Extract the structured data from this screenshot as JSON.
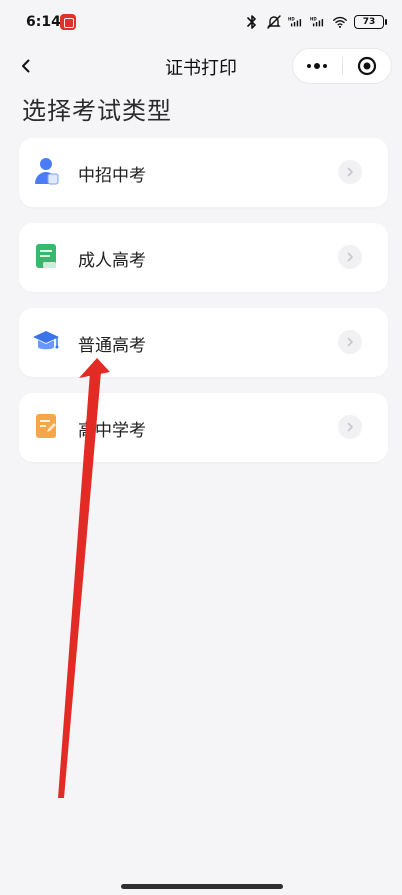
{
  "status_bar": {
    "time": "6:14",
    "battery": "73",
    "icons": [
      "bluetooth-icon",
      "mute-bell-icon",
      "hd-signal-icon",
      "hd-signal-icon",
      "wifi-icon",
      "battery-icon"
    ]
  },
  "header": {
    "title": "证书打印",
    "back_icon": "chevron-left-icon",
    "more_icon": "more-icon",
    "close_icon": "target-icon"
  },
  "page": {
    "heading": "选择考试类型"
  },
  "options": [
    {
      "label": "中招中考",
      "icon": "user-icon",
      "color": "#4c7cf5"
    },
    {
      "label": "成人高考",
      "icon": "book-icon",
      "color": "#37b86f"
    },
    {
      "label": "普通高考",
      "icon": "graduation-cap-icon",
      "color": "#3b73e8"
    },
    {
      "label": "高中学考",
      "icon": "note-icon",
      "color": "#f6a64a"
    }
  ],
  "colors": {
    "background": "#f5f5f7",
    "card": "#ffffff",
    "annotation_arrow": "#e32b25"
  }
}
